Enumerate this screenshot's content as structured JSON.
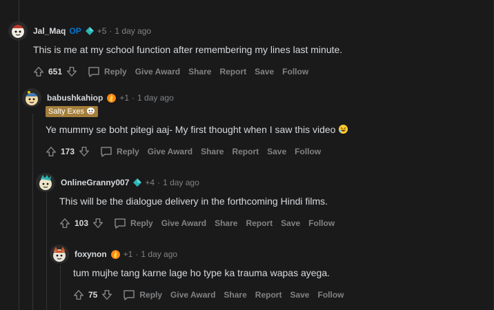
{
  "comments": [
    {
      "username": "Jal_Maq",
      "op_label": "OP",
      "karma": "+5",
      "time": "1 day ago",
      "text": "This is me at my school function after remembering my lines last minute.",
      "score": "651",
      "avatar_color": "#e8e3d6"
    },
    {
      "username": "babushkahiop",
      "karma": "+1",
      "time": "1 day ago",
      "flair": "Salty Exes",
      "text": "Ye mummy se boht pitegi aaj- My first thought when I saw this video",
      "score": "173",
      "avatar_color": "#3d7cb8"
    },
    {
      "username": "OnlineGranny007",
      "karma": "+4",
      "time": "1 day ago",
      "text": "This will be the dialogue delivery in the forthcoming Hindi films.",
      "score": "103",
      "avatar_color": "#e9e2c9"
    },
    {
      "username": "foxynon",
      "karma": "+1",
      "time": "1 day ago",
      "text": "tum mujhe tang karne lage ho type ka trauma wapas ayega.",
      "score": "75",
      "avatar_color": "#c9562b"
    }
  ],
  "actions": {
    "reply": "Reply",
    "give_award": "Give Award",
    "share": "Share",
    "report": "Report",
    "save": "Save",
    "follow": "Follow"
  },
  "icons": {
    "upvote": "upvote-arrow-icon",
    "downvote": "downvote-arrow-icon",
    "reply": "comment-bubble-icon",
    "badge_diamond": "diamond-badge-icon",
    "badge_award": "fire-award-icon",
    "emoji": "rofl-emoji-icon"
  },
  "colors": {
    "background": "#1a1a1b",
    "text": "#d7dadc",
    "muted": "#818384",
    "op": "#0079d3",
    "flair_bg": "#a47e3b"
  }
}
